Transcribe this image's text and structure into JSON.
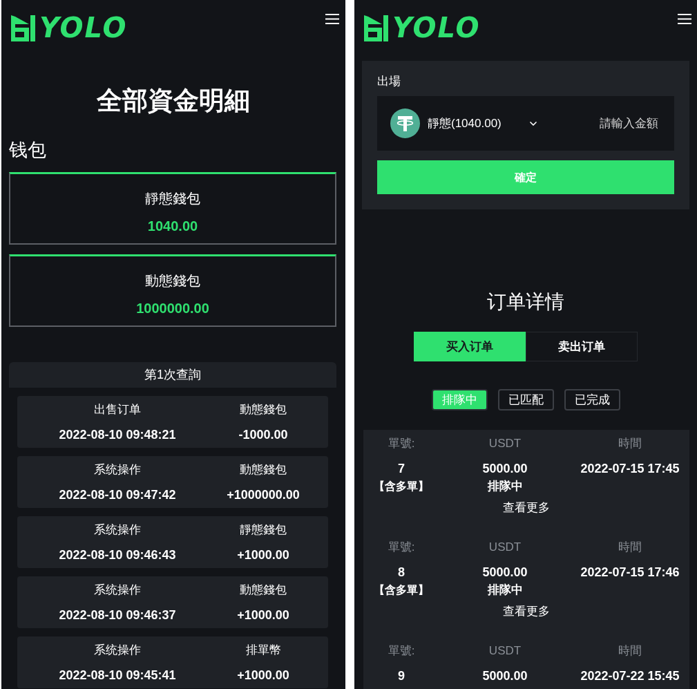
{
  "fund_details_screen": {
    "logo": "YOLO",
    "title": "全部資金明細",
    "wallet_heading": "钱包",
    "wallets": [
      {
        "label": "靜態錢包",
        "amount": "1040.00"
      },
      {
        "label": "動態錢包",
        "amount": "1000000.00"
      }
    ],
    "query": {
      "title": "第1次查詢",
      "records": [
        {
          "type": "出售订单",
          "wallet": "動態錢包",
          "time": "2022-08-10 09:48:21",
          "amount": "-1000.00"
        },
        {
          "type": "系统操作",
          "wallet": "動態錢包",
          "time": "2022-08-10 09:47:42",
          "amount": "+1000000.00"
        },
        {
          "type": "系统操作",
          "wallet": "靜態錢包",
          "time": "2022-08-10 09:46:43",
          "amount": "+1000.00"
        },
        {
          "type": "系统操作",
          "wallet": "動態錢包",
          "time": "2022-08-10 09:46:37",
          "amount": "+1000.00"
        },
        {
          "type": "系统操作",
          "wallet": "排單幣",
          "time": "2022-08-10 09:45:41",
          "amount": "+1000.00"
        }
      ]
    }
  },
  "withdraw_screen": {
    "logo": "YOLO",
    "withdraw": {
      "label": "出場",
      "wallet_option": "靜態(1040.00)",
      "amount_placeholder": "請輸入金額",
      "confirm_button": "確定"
    },
    "orders_title": "订单详情",
    "tabs": [
      {
        "label": "买入订单",
        "selected": true
      },
      {
        "label": "卖出订单",
        "selected": false
      }
    ],
    "filters": [
      {
        "label": "排隊中",
        "selected": true
      },
      {
        "label": "已匹配",
        "selected": false
      },
      {
        "label": "已完成",
        "selected": false
      }
    ],
    "orders": [
      {
        "headers": [
          "單號:",
          "USDT",
          "時間"
        ],
        "number": "7",
        "tag": "【含多單】",
        "amount": "5000.00",
        "status": "排隊中",
        "time": "2022-07-15 17:45",
        "more": "查看更多"
      },
      {
        "headers": [
          "單號:",
          "USDT",
          "時間"
        ],
        "number": "8",
        "tag": "【含多單】",
        "amount": "5000.00",
        "status": "排隊中",
        "time": "2022-07-15 17:46",
        "more": "查看更多"
      },
      {
        "headers": [
          "單號:",
          "USDT",
          "時間"
        ],
        "number": "9",
        "amount": "5000.00",
        "time": "2022-07-22 15:45"
      }
    ]
  }
}
